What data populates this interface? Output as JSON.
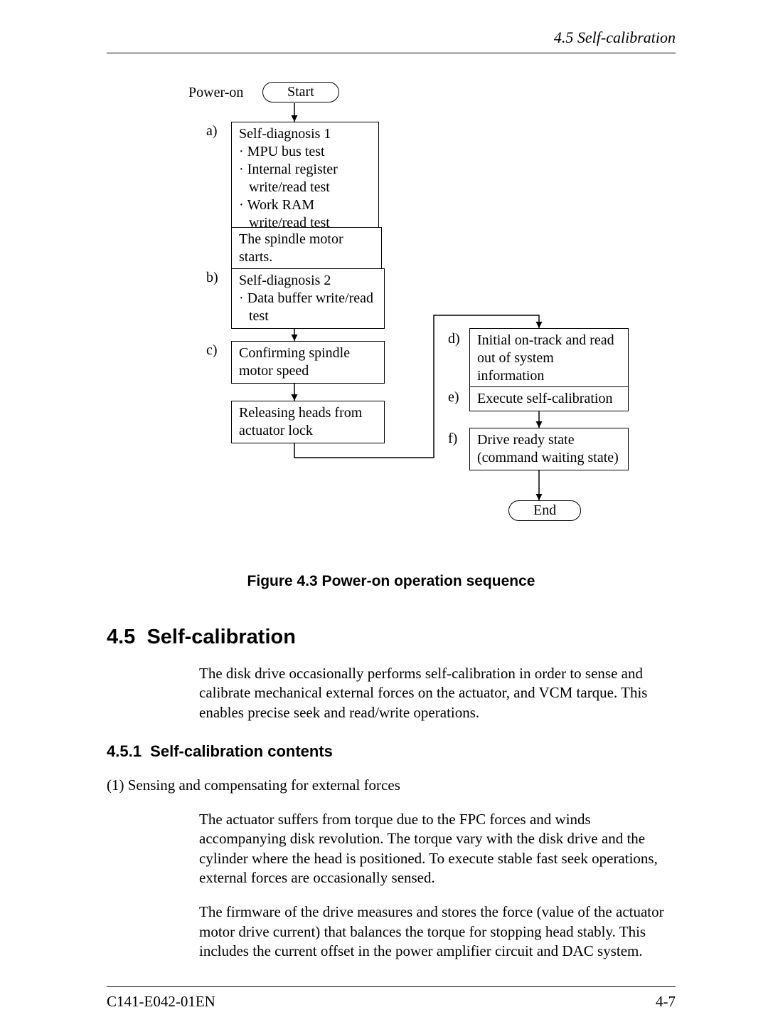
{
  "header": {
    "running": "4.5  Self-calibration"
  },
  "flow": {
    "power_on": "Power-on",
    "start": "Start",
    "a_label": "a)",
    "a_title": "Self-diagnosis 1",
    "a_items": [
      "MPU bus test",
      "Internal register write/read test",
      "Work RAM write/read test"
    ],
    "spindle_start": "The spindle motor starts.",
    "b_label": "b)",
    "b_title": "Self-diagnosis 2",
    "b_items": [
      "Data buffer write/read test"
    ],
    "c_label": "c)",
    "c_text": "Confirming spindle motor speed",
    "release": "Releasing heads from actuator lock",
    "d_label": "d)",
    "d_text": "Initial on-track and read out of system information",
    "e_label": "e)",
    "e_text": "Execute self-calibration",
    "f_label": "f)",
    "f_text": "Drive ready state (command waiting state)",
    "end": "End"
  },
  "caption": "Figure 4.3  Power-on operation sequence",
  "section": {
    "num": "4.5",
    "title": "Self-calibration"
  },
  "para1": "The disk drive occasionally performs self-calibration in order to sense and calibrate mechanical external forces on the actuator, and VCM tarque.  This enables precise seek and read/write operations.",
  "subsection": {
    "num": "4.5.1",
    "title": "Self-calibration contents"
  },
  "item1_intro": "(1)  Sensing and compensating for external forces",
  "item1_p1": "The actuator suffers from torque due to the FPC forces and winds accompanying disk revolution.  The torque vary with the disk drive and the cylinder where the head is positioned.  To execute stable fast seek operations, external forces are occasionally sensed.",
  "item1_p2": "The firmware of the drive measures and stores the force (value of the actuator motor drive current) that balances the torque for stopping head stably.  This includes the current offset in the power amplifier circuit and DAC system.",
  "footer": {
    "doc": "C141-E042-01EN",
    "page": "4-7"
  }
}
